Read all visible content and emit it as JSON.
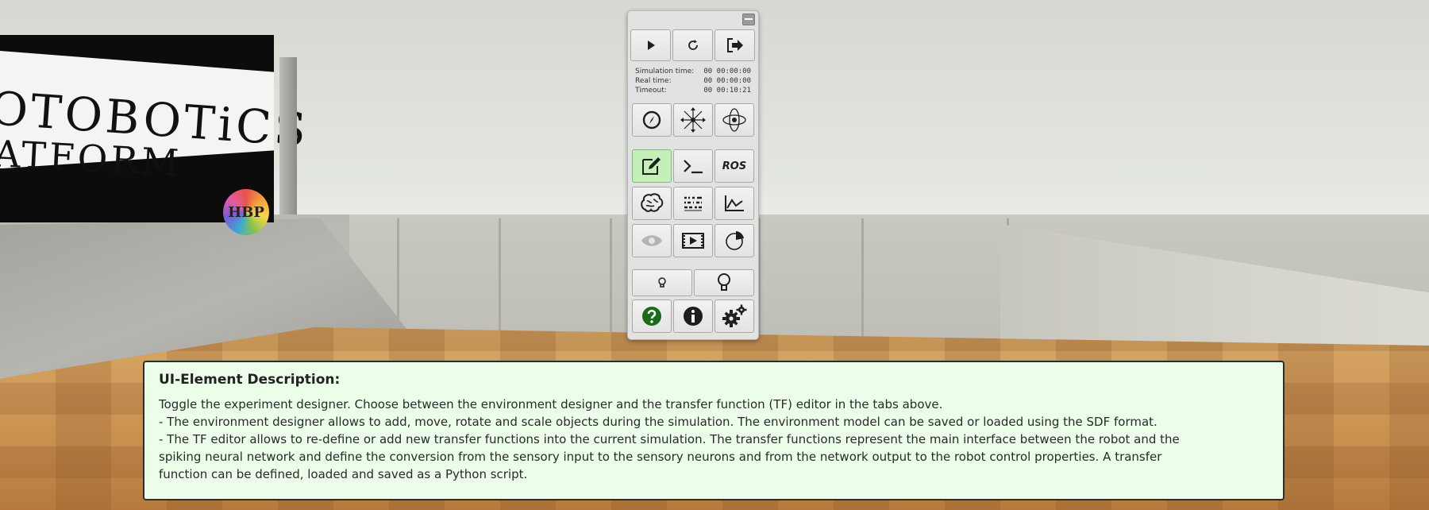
{
  "scene": {
    "banner_line1": "OTOBOTiCS",
    "banner_line2": "ATFORM",
    "logo_text": "HBP"
  },
  "panel": {
    "row1": [
      {
        "icon": "play-icon",
        "label": "Start"
      },
      {
        "icon": "reset-icon",
        "label": "Reset"
      },
      {
        "icon": "exit-icon",
        "label": "Exit"
      }
    ],
    "times": [
      {
        "label": "Simulation time:",
        "value": "00 00:00:00"
      },
      {
        "label": "Real time:",
        "value": "00 00:00:00"
      },
      {
        "label": "Timeout:",
        "value": "00 00:10:21"
      }
    ],
    "ros_label": "ROS",
    "active_button": "experiment-designer"
  },
  "description": {
    "title": "UI-Element Description:",
    "lines": [
      "Toggle the experiment designer. Choose between the environment designer and the transfer function (TF) editor in the tabs above.",
      "- The environment designer allows to add, move, rotate and scale objects during the simulation. The environment model can be saved or loaded using the SDF format.",
      "- The TF editor allows to re-define or add new transfer functions into the current simulation. The transfer functions represent the main interface between the robot and the",
      "spiking neural network and define the conversion from the sensory input to the sensory neurons and from the network output to the robot control properties. A transfer",
      "function can be defined, loaded and saved as a Python script."
    ]
  },
  "colors": {
    "active_button": "#c3f0b7",
    "description_bg": "#ecfdea",
    "help_icon": "#1a6b1a"
  }
}
